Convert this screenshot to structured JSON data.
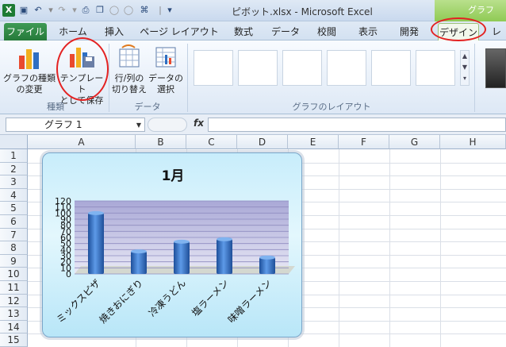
{
  "window": {
    "title": "ピボット.xlsx  -  Microsoft Excel",
    "context_tab_group": "グラフ"
  },
  "quick_access": {
    "icons": [
      "excel-logo-icon",
      "save-icon",
      "undo-icon",
      "redo-icon",
      "print-preview-icon",
      "open-icon",
      "circle-icon",
      "circle-icon",
      "share-icon",
      "customize-icon"
    ]
  },
  "tabs": [
    {
      "label": "ファイル"
    },
    {
      "label": "ホーム"
    },
    {
      "label": "挿入"
    },
    {
      "label": "ページ レイアウト"
    },
    {
      "label": "数式"
    },
    {
      "label": "データ"
    },
    {
      "label": "校閲"
    },
    {
      "label": "表示"
    },
    {
      "label": "開発"
    },
    {
      "label": "デザイン"
    },
    {
      "label": "レ"
    }
  ],
  "ribbon": {
    "change_type_line1": "グラフの種類",
    "change_type_line2": "の変更",
    "save_template_line1": "テンプレート",
    "save_template_line2": "として保存",
    "switch_row_col_line1": "行/列の",
    "switch_row_col_line2": "切り替え",
    "select_data_line1": "データの",
    "select_data_line2": "選択",
    "group_type": "種類",
    "group_data": "データ",
    "group_layouts": "グラフのレイアウト"
  },
  "formula_bar": {
    "name_box": "グラフ 1",
    "fx": "fx",
    "formula": ""
  },
  "sheet": {
    "columns": [
      "A",
      "B",
      "C",
      "D",
      "E",
      "F",
      "G",
      "H"
    ],
    "rows": [
      "1",
      "2",
      "3",
      "4",
      "5",
      "6",
      "7",
      "8",
      "9",
      "10",
      "11",
      "12",
      "13",
      "14",
      "15"
    ]
  },
  "colors": {
    "accent_red": "#e32222",
    "bar": "#2f6fc2",
    "plot_top": "#a9a8d6",
    "chart_bg": "#d6f2fc"
  },
  "chart_data": {
    "type": "bar",
    "title": "1月",
    "categories": [
      "ミックスピザ",
      "焼きおにぎり",
      "冷凍うどん",
      "塩ラーメン",
      "味噌ラーメン"
    ],
    "values": [
      100,
      37,
      53,
      57,
      27
    ],
    "ylim": [
      0,
      120
    ],
    "yticks": [
      "0",
      "10",
      "20",
      "30",
      "40",
      "50",
      "60",
      "70",
      "80",
      "90",
      "100",
      "110",
      "120"
    ],
    "grid": true,
    "legend": "none"
  }
}
